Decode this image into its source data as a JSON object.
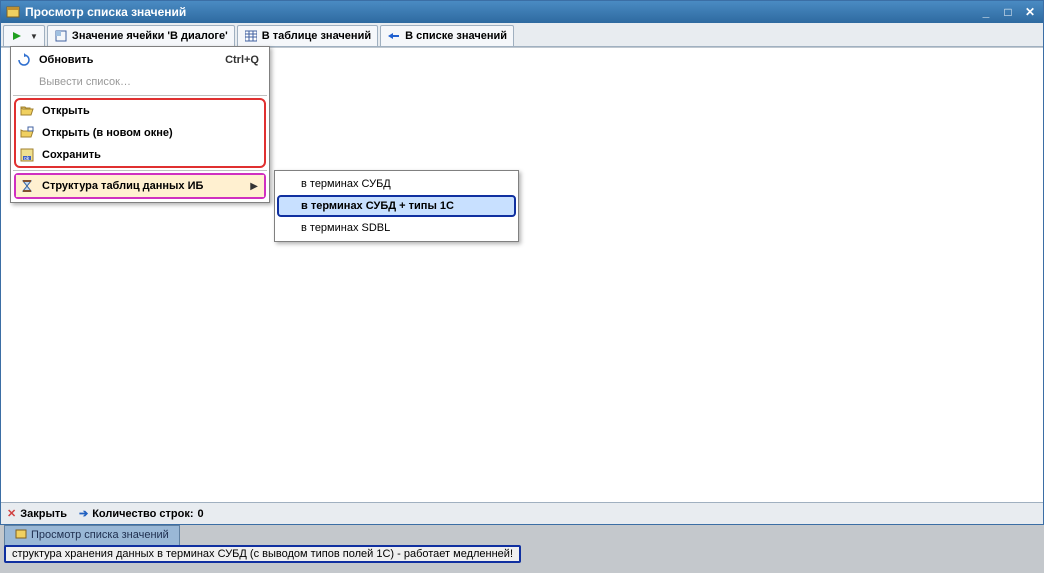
{
  "window": {
    "title": "Просмотр списка значений"
  },
  "toolbar": {
    "cell_value": "Значение ячейки 'В диалоге'",
    "in_table": "В таблице значений",
    "in_list": "В списке значений"
  },
  "menu": {
    "refresh": {
      "label": "Обновить",
      "shortcut": "Ctrl+Q"
    },
    "export": {
      "label": "Вывести список…"
    },
    "open": {
      "label": "Открыть"
    },
    "open_new": {
      "label": "Открыть (в новом окне)"
    },
    "save": {
      "label": "Сохранить"
    },
    "structure": {
      "label": "Структура таблиц данных ИБ"
    }
  },
  "submenu": {
    "sub1": "в терминах СУБД",
    "sub2": "в терминах СУБД + типы 1С",
    "sub3": "в терминах SDBL"
  },
  "bottombar": {
    "close": "Закрыть",
    "rowcount_label": "Количество строк:",
    "rowcount_value": "0"
  },
  "footer": {
    "tab": "Просмотр списка значений",
    "status": "структура хранения данных в терминах СУБД (с выводом типов полей 1С) - работает медленней!"
  }
}
